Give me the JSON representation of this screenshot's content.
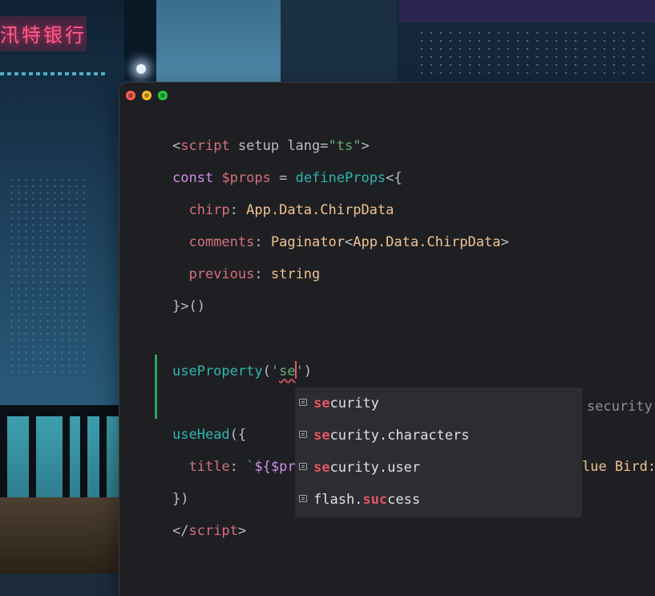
{
  "background": {
    "sign_text": "汛特银行"
  },
  "window": {
    "buttons": {
      "close": "close-button",
      "minimize": "minimize-button",
      "maximize": "maximize-button"
    }
  },
  "code": {
    "line1": {
      "open": "<",
      "tag": "script",
      "attrs": " setup lang=",
      "value": "\"ts\"",
      "close": ">"
    },
    "line2": {
      "kw": "const",
      "sp": " ",
      "var": "$props",
      "eq": " = ",
      "fn": "defineProps",
      "rest": "<{"
    },
    "line3": {
      "indent": "  ",
      "prop": "chirp",
      "colon": ": ",
      "type": "App.Data.ChirpData"
    },
    "line4": {
      "indent": "  ",
      "prop": "comments",
      "colon": ": ",
      "type1": "Paginator",
      "lt": "<",
      "type2": "App.Data.ChirpData",
      "gt": ">"
    },
    "line5": {
      "indent": "  ",
      "prop": "previous",
      "colon": ": ",
      "type": "string"
    },
    "line6": {
      "text": "}>()"
    },
    "line7": {
      "fn": "useProperty",
      "paren": "(",
      "q1": "'",
      "typed": "se",
      "q2": "'",
      "close": ")"
    },
    "line8": {
      "fn": "useHead",
      "rest": "({"
    },
    "line9": {
      "indent": "  ",
      "prop": "title",
      "colon": ": ",
      "tick": "`",
      "tpl": "${$pr"
    },
    "line10": {
      "text": "})"
    },
    "line11": {
      "open": "</",
      "tag": "script",
      "close": ">"
    }
  },
  "completion": {
    "items": [
      {
        "match": "se",
        "rest": "curity"
      },
      {
        "match": "se",
        "rest": "curity.characters"
      },
      {
        "match": "se",
        "rest": "curity.user"
      },
      {
        "pre": "flash.",
        "match": "suc",
        "rest": "cess"
      }
    ],
    "hint": "security",
    "overflow_text": "lue Bird:"
  }
}
